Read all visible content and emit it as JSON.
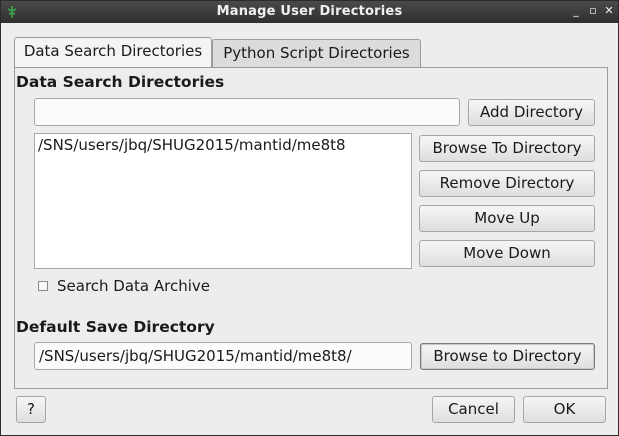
{
  "window": {
    "title": "Manage User Directories",
    "controls": {
      "minimize": "_",
      "maximize": "▫",
      "close": "✕"
    }
  },
  "tabs": [
    {
      "label": "Data Search Directories",
      "active": true
    },
    {
      "label": "Python Script Directories",
      "active": false
    }
  ],
  "data_search": {
    "heading": "Data Search Directories",
    "new_dir_value": "",
    "add_button": "Add Directory",
    "directories": [
      "/SNS/users/jbq/SHUG2015/mantid/me8t8"
    ],
    "browse_button": "Browse To Directory",
    "remove_button": "Remove Directory",
    "move_up_button": "Move Up",
    "move_down_button": "Move Down",
    "search_archive_label": "Search Data Archive",
    "search_archive_checked": false
  },
  "default_save": {
    "heading": "Default Save Directory",
    "value": "/SNS/users/jbq/SHUG2015/mantid/me8t8/",
    "browse_button": "Browse to Directory"
  },
  "footer": {
    "help_button": "?",
    "cancel_button": "Cancel",
    "ok_button": "OK"
  },
  "colors": {
    "titlebar": "#3a3a3a",
    "background": "#ededed",
    "app_icon": "#3aa84a"
  }
}
